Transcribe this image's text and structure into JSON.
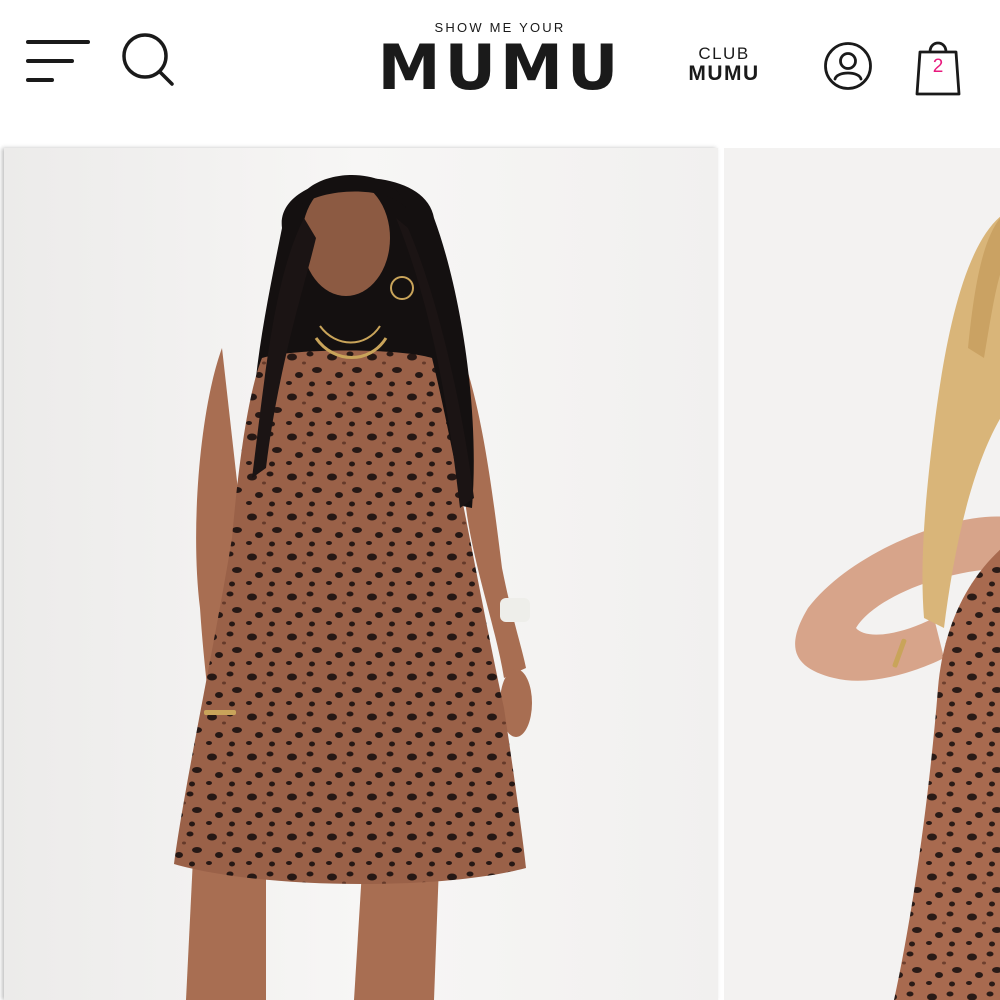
{
  "header": {
    "brand_small": "SHOW ME YOUR",
    "brand_big": "MUMU",
    "club_line1": "CLUB",
    "club_line2": "MUMU",
    "cart_count": "2",
    "icons": {
      "menu": "hamburger-menu-icon",
      "search": "search-icon",
      "account": "user-account-icon",
      "bag": "shopping-bag-icon"
    },
    "colors": {
      "text": "#1a1a1a",
      "cart_badge": "#e8197d"
    }
  },
  "gallery": {
    "images": [
      {
        "subject": "model-curly-dark-hair-leopard-dress"
      },
      {
        "subject": "model-blonde-hair-leopard-dress"
      }
    ],
    "colors": {
      "background": "#f4f3f2",
      "print_base": "#a86a4f",
      "print_spot": "#2a1b17"
    }
  }
}
